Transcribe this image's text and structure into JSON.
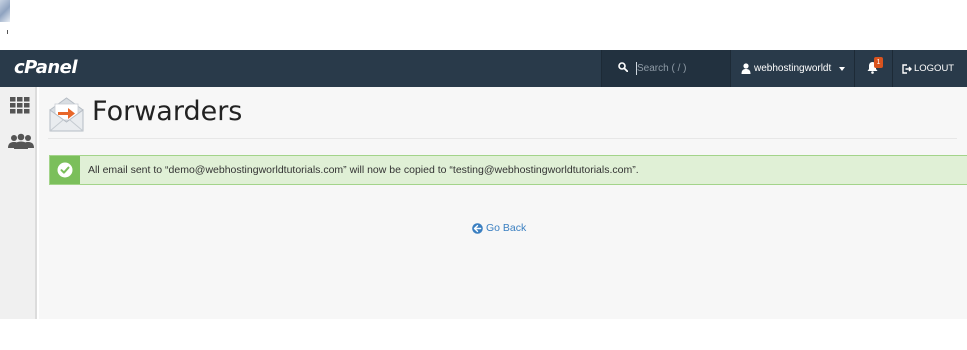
{
  "navbar": {
    "logo": "cPanel",
    "search_placeholder": "Search ( / )",
    "username": "webhostingworldt",
    "notification_count": "1",
    "logout_label": "LOGOUT"
  },
  "sidebar": {
    "items": [
      {
        "icon": "grid-icon"
      },
      {
        "icon": "users-icon"
      }
    ]
  },
  "page": {
    "title": "Forwarders",
    "alert_message": "All email sent to “demo@webhostingworldtutorials.com” will now be copied to “testing@webhostingworldtutorials.com”.",
    "go_back_label": "Go Back"
  },
  "colors": {
    "navbar_bg": "#293a4a",
    "alert_bg": "#e0f0d6",
    "alert_border": "#a3d48a",
    "success_icon": "#7bbf5b",
    "link": "#3a7fc1",
    "badge": "#d9531e"
  }
}
